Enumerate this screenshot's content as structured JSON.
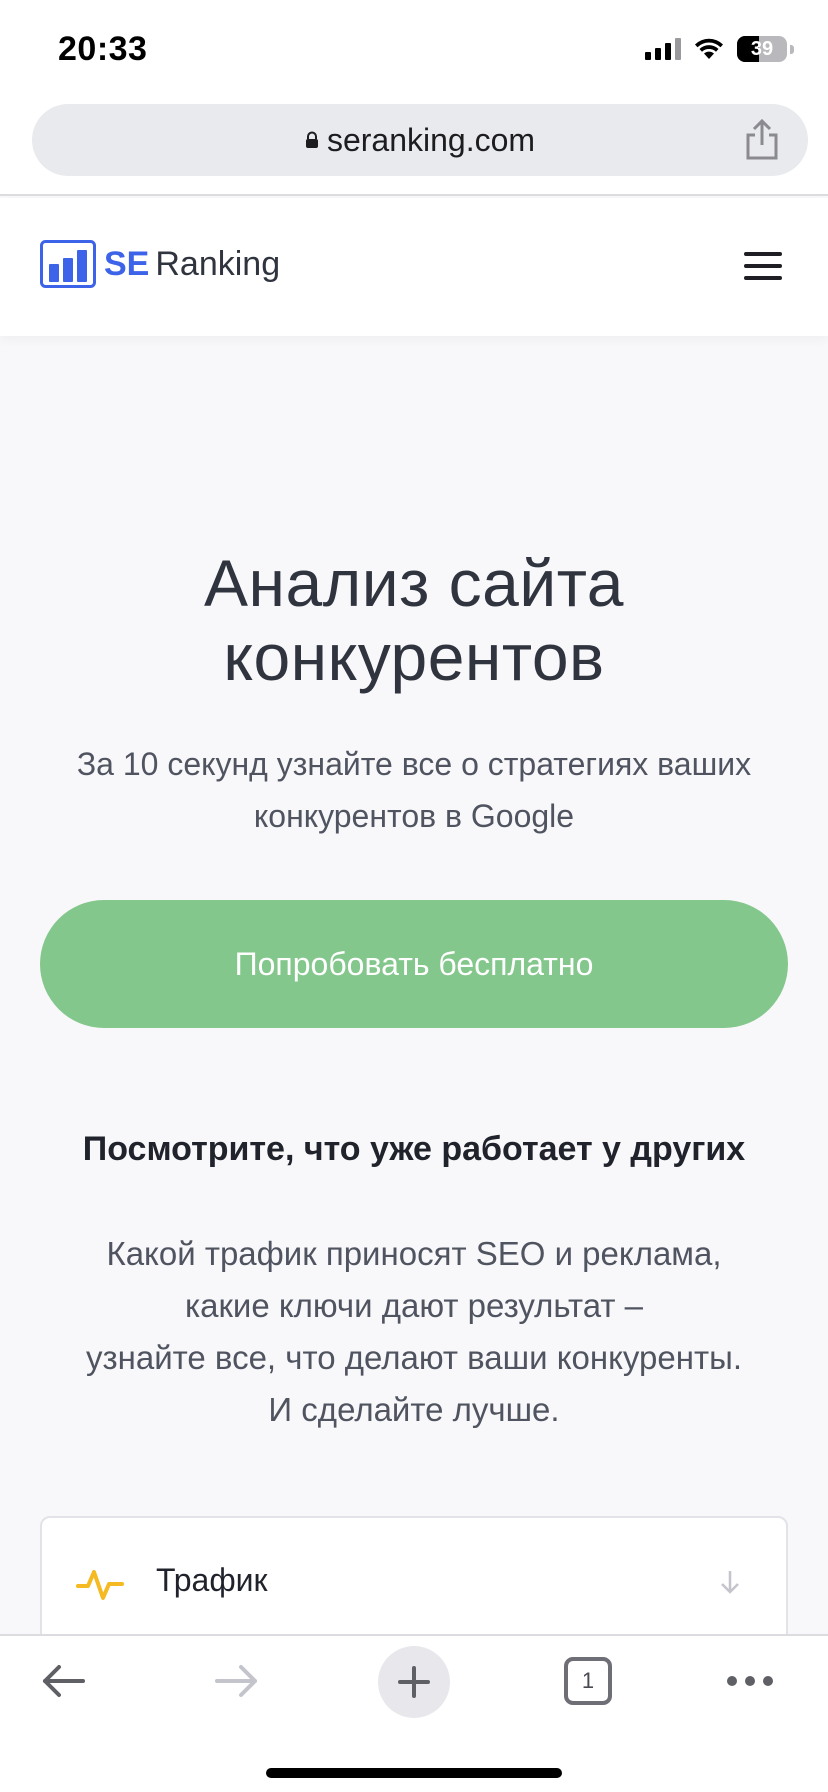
{
  "status_bar": {
    "time": "20:33",
    "battery": "39",
    "icons": [
      "signal-icon",
      "wifi-icon",
      "battery-icon"
    ]
  },
  "browser": {
    "url": "seranking.com",
    "icons": [
      "lock-icon",
      "share-icon"
    ]
  },
  "header": {
    "logo_se": "SE",
    "logo_ranking": "Ranking",
    "menu_icon": "hamburger-menu-icon",
    "brand_color": "#3c63e8"
  },
  "hero": {
    "title": "Анализ сайта конкурентов",
    "subtitle": "За 10 секунд узнайте все о стратегиях ваших конкурентов в Google",
    "cta_label": "Попробовать бесплатно",
    "cta_color": "#84c78c"
  },
  "section": {
    "heading": "Посмотрите, что уже работает у других",
    "text_line1": "Какой трафик приносят SEO и реклама,",
    "text_line2": "какие ключи дают результат –",
    "text_line3": "узнайте все, что делают ваши конкуренты.",
    "text_line4": "И сделайте лучше."
  },
  "card": {
    "title": "Трафик",
    "icon": "pulse-icon",
    "icon_color": "#f5b921",
    "arrow": "arrow-down-icon"
  },
  "toolbar": {
    "tab_count": "1",
    "icons": [
      "back-arrow-icon",
      "forward-arrow-icon",
      "plus-icon",
      "tabs-icon",
      "more-icon"
    ]
  }
}
